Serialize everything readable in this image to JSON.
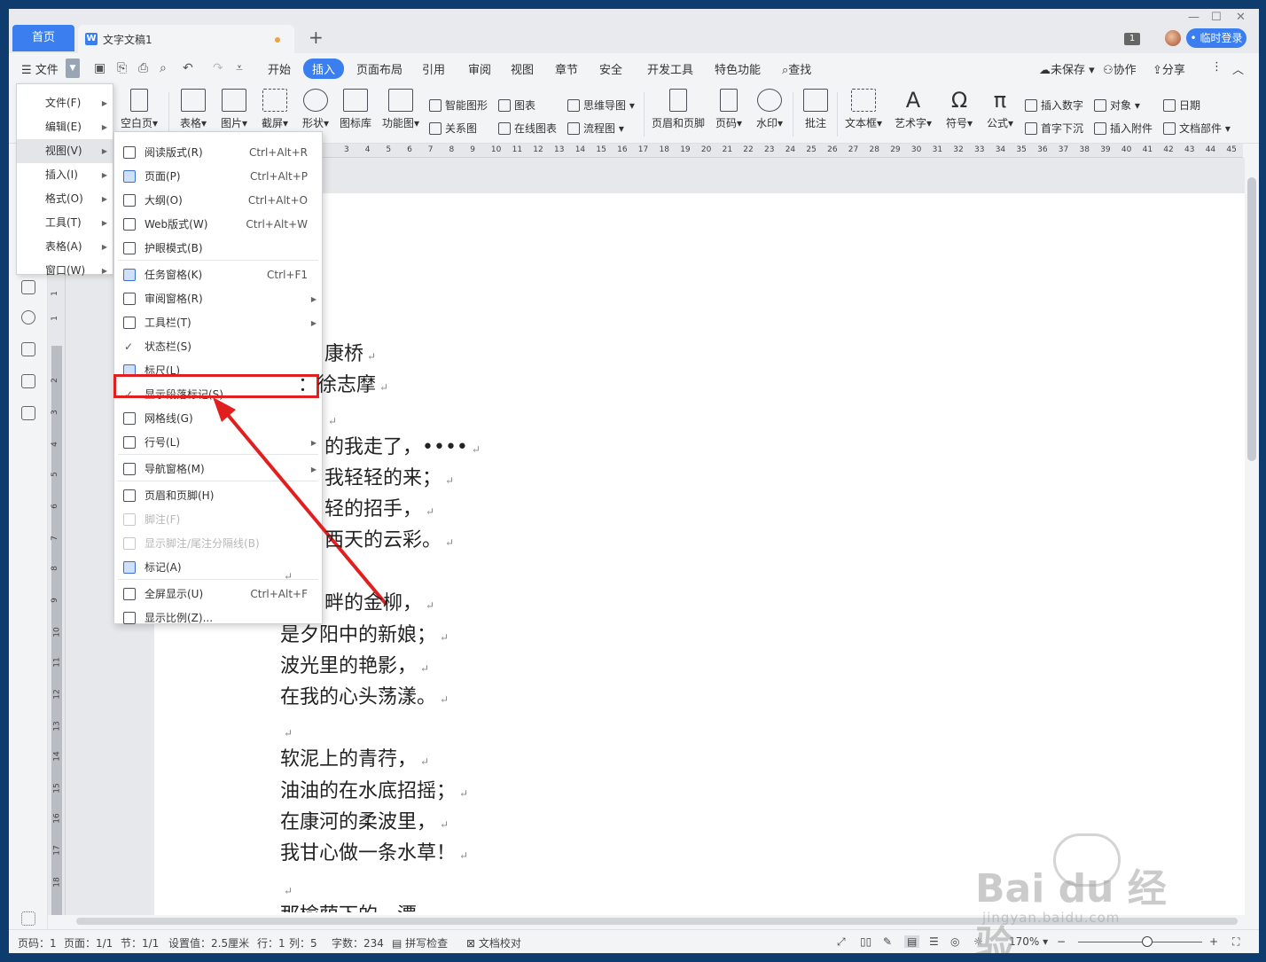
{
  "tabs": {
    "home": "首页",
    "doc": "文字文稿1",
    "new": "+"
  },
  "window_controls": {
    "min": "—",
    "max": "☐",
    "close": "✕"
  },
  "title_right": {
    "badge": "1",
    "login": "• 临时登录"
  },
  "menubar": {
    "file": "文件",
    "items": [
      "开始",
      "插入",
      "页面布局",
      "引用",
      "审阅",
      "视图",
      "章节",
      "安全",
      "开发工具",
      "特色功能"
    ],
    "active": "插入",
    "search": "查找",
    "unsaved": "未保存",
    "collab": "协作",
    "share": "分享"
  },
  "ribbon": {
    "blank_page": "空白页",
    "table": "表格",
    "picture": "图片",
    "screenshot": "截屏",
    "shape": "形状",
    "icon_lib": "图标库",
    "func_chart": "功能图",
    "smart_shape": "智能图形",
    "chart": "图表",
    "mindmap": "思维导图",
    "relation": "关系图",
    "online_chart": "在线图表",
    "flowchart": "流程图",
    "header_footer": "页眉和页脚",
    "page_num": "页码",
    "watermark": "水印",
    "comment": "批注",
    "textbox": "文本框",
    "wordart": "艺术字",
    "symbol": "符号",
    "formula": "公式",
    "insert_number": "插入数字",
    "object": "对象",
    "date": "日期",
    "drop_cap": "首字下沉",
    "attachment": "插入附件",
    "doc_parts": "文档部件"
  },
  "ruler_ticks": [
    "3",
    "4",
    "5",
    "6",
    "7",
    "8",
    "9",
    "10",
    "11",
    "12",
    "13",
    "14",
    "15",
    "16",
    "17",
    "18",
    "19",
    "20",
    "21",
    "22",
    "23",
    "24",
    "25",
    "26",
    "27",
    "28",
    "29",
    "30",
    "31",
    "32",
    "33",
    "34",
    "35",
    "36",
    "37",
    "38",
    "39",
    "40",
    "41",
    "42",
    "43",
    "44",
    "45"
  ],
  "vruler_ticks": [
    "1",
    "1",
    "2",
    "3",
    "4",
    "5",
    "6",
    "7",
    "8",
    "9",
    "10",
    "11",
    "12",
    "13",
    "14",
    "15",
    "16",
    "17",
    "18"
  ],
  "menu_level1": [
    {
      "label": "文件(F)"
    },
    {
      "label": "编辑(E)"
    },
    {
      "label": "视图(V)"
    },
    {
      "label": "插入(I)"
    },
    {
      "label": "格式(O)"
    },
    {
      "label": "工具(T)"
    },
    {
      "label": "表格(A)"
    },
    {
      "label": "窗口(W)"
    }
  ],
  "menu_view": [
    {
      "label": "阅读版式(R)",
      "shortcut": "Ctrl+Alt+R"
    },
    {
      "label": "页面(P)",
      "shortcut": "Ctrl+Alt+P"
    },
    {
      "label": "大纲(O)",
      "shortcut": "Ctrl+Alt+O"
    },
    {
      "label": "Web版式(W)",
      "shortcut": "Ctrl+Alt+W"
    },
    {
      "label": "护眼模式(B)",
      "shortcut": ""
    },
    {
      "label": "任务窗格(K)",
      "shortcut": "Ctrl+F1"
    },
    {
      "label": "审阅窗格(R)",
      "shortcut": ""
    },
    {
      "label": "工具栏(T)",
      "shortcut": ""
    },
    {
      "label": "状态栏(S)",
      "shortcut": ""
    },
    {
      "label": "标尺(L)",
      "shortcut": ""
    },
    {
      "label": "显示段落标记(S)",
      "shortcut": ""
    },
    {
      "label": "网格线(G)",
      "shortcut": ""
    },
    {
      "label": "行号(L)",
      "shortcut": ""
    },
    {
      "label": "导航窗格(M)",
      "shortcut": ""
    },
    {
      "label": "页眉和页脚(H)",
      "shortcut": ""
    },
    {
      "label": "脚注(F)",
      "shortcut": ""
    },
    {
      "label": "显示脚注/尾注分隔线(B)",
      "shortcut": ""
    },
    {
      "label": "标记(A)",
      "shortcut": ""
    },
    {
      "label": "全屏显示(U)",
      "shortcut": "Ctrl+Alt+F"
    },
    {
      "label": "显示比例(Z)...",
      "shortcut": ""
    }
  ],
  "poem": [
    "康桥",
    "：徐志摩",
    "",
    "的我走了，••••",
    "我轻轻的来；",
    "轻的招手，",
    "西天的云彩。",
    "",
    "畔的金柳，",
    "是夕阳中的新娘；",
    "波光里的艳影，",
    "在我的心头荡漾。",
    "",
    "软泥上的青荇，",
    "油油的在水底招摇；",
    "在康河的柔波里，",
    "我甘心做一条水草！",
    "",
    "那榆荫下的一潭"
  ],
  "status": {
    "page_code": "页码：1",
    "pages": "页面：1/1",
    "section": "节：1/1",
    "setting": "设置值：2.5厘米",
    "row": "行：1",
    "col": "列：5",
    "words": "字数：234",
    "spell": "拼写检查",
    "proof": "文档校对",
    "zoom": "170%"
  },
  "watermark": {
    "brand": "Bai du 经验",
    "url": "jingyan.baidu.com"
  }
}
